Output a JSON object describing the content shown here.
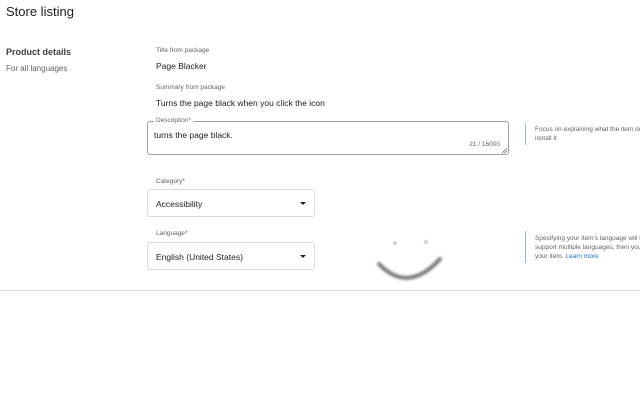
{
  "page": {
    "title": "Store listing"
  },
  "section": {
    "title": "Product details",
    "subtitle": "For all languages"
  },
  "fields": {
    "title_from_package": {
      "label": "Title from package",
      "value": "Page Blacker"
    },
    "summary_from_package": {
      "label": "Summary from package",
      "value": "Turns the page black when you click the icon"
    },
    "description": {
      "label": "Description*",
      "value": "turns the page black.",
      "counter": "21 / 16000"
    },
    "category": {
      "label": "Category*",
      "value": "Accessibility"
    },
    "language": {
      "label": "Language*",
      "value": "English (United States)"
    }
  },
  "hints": {
    "description": {
      "lines": [
        "Focus on explaining what the item does",
        "install it"
      ]
    },
    "language": {
      "lines": [
        "Specifying your item's language will he",
        "support multiple languages, then you",
        "your item."
      ],
      "link": "Learn more"
    }
  },
  "colors": {
    "accent": "#1a73e8",
    "hint_border": "#8ab4f8",
    "divider": "#dadce0"
  },
  "icons": {
    "dropdown": "dropdown-arrow-icon",
    "resize": "resize-grip-icon",
    "decoration": "smiley-face-icon"
  }
}
